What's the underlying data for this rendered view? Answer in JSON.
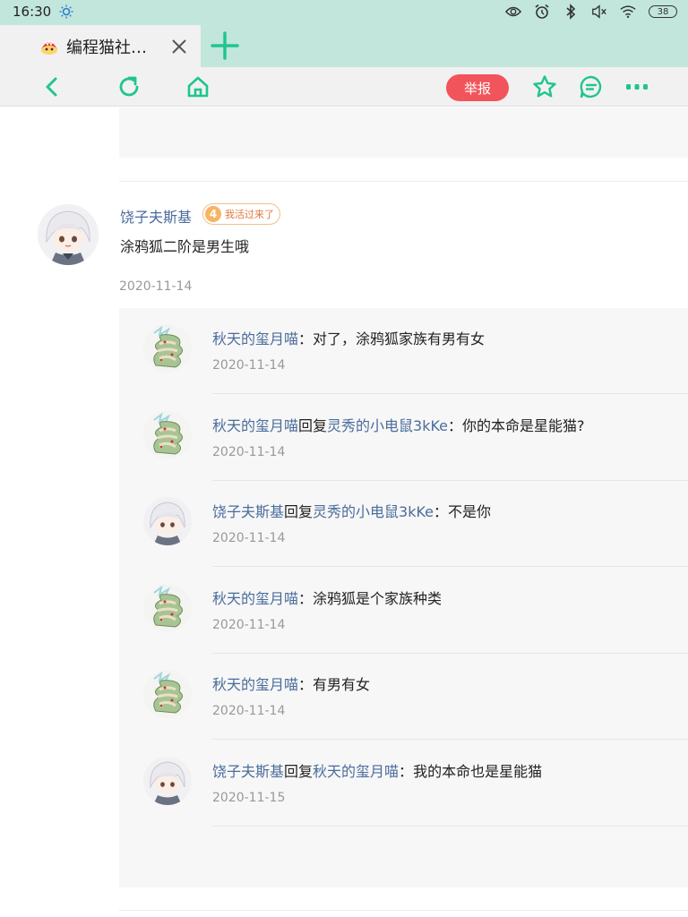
{
  "status_bar": {
    "time": "16:30",
    "battery": "38"
  },
  "tab": {
    "title": "编程猫社…"
  },
  "toolbar": {
    "report_label": "举报"
  },
  "comment": {
    "author": "饶子夫斯基",
    "level": "4",
    "badge_text": "我活过来了",
    "text": "涂鸦狐二阶是男生哦",
    "date": "2020-11-14"
  },
  "replies": [
    {
      "author": "秋天的玺月喵",
      "reply_word": "",
      "target": "",
      "sep": "：",
      "text": "对了，涂鸦狐家族有男有女",
      "date": "2020-11-14",
      "avatar": "green"
    },
    {
      "author": "秋天的玺月喵",
      "reply_word": "回复",
      "target": "灵秀的小电鼠3kKe",
      "sep": "：",
      "text": "你的本命是星能猫?",
      "date": "2020-11-14",
      "avatar": "green"
    },
    {
      "author": "饶子夫斯基",
      "reply_word": "回复",
      "target": "灵秀的小电鼠3kKe",
      "sep": "：",
      "text": "不是你",
      "date": "2020-11-14",
      "avatar": "white"
    },
    {
      "author": "秋天的玺月喵",
      "reply_word": "",
      "target": "",
      "sep": "：",
      "text": "涂鸦狐是个家族种类",
      "date": "2020-11-14",
      "avatar": "green"
    },
    {
      "author": "秋天的玺月喵",
      "reply_word": "",
      "target": "",
      "sep": "：",
      "text": "有男有女",
      "date": "2020-11-14",
      "avatar": "green"
    },
    {
      "author": "饶子夫斯基",
      "reply_word": "回复",
      "target": "秋天的玺月喵",
      "sep": "：",
      "text": "我的本命也是星能猫",
      "date": "2020-11-15",
      "avatar": "white"
    }
  ],
  "colors": {
    "accent": "#1fc58f",
    "name_link": "#4a6c9b",
    "report": "#f2545b",
    "tabbar": "#c2e6db"
  }
}
